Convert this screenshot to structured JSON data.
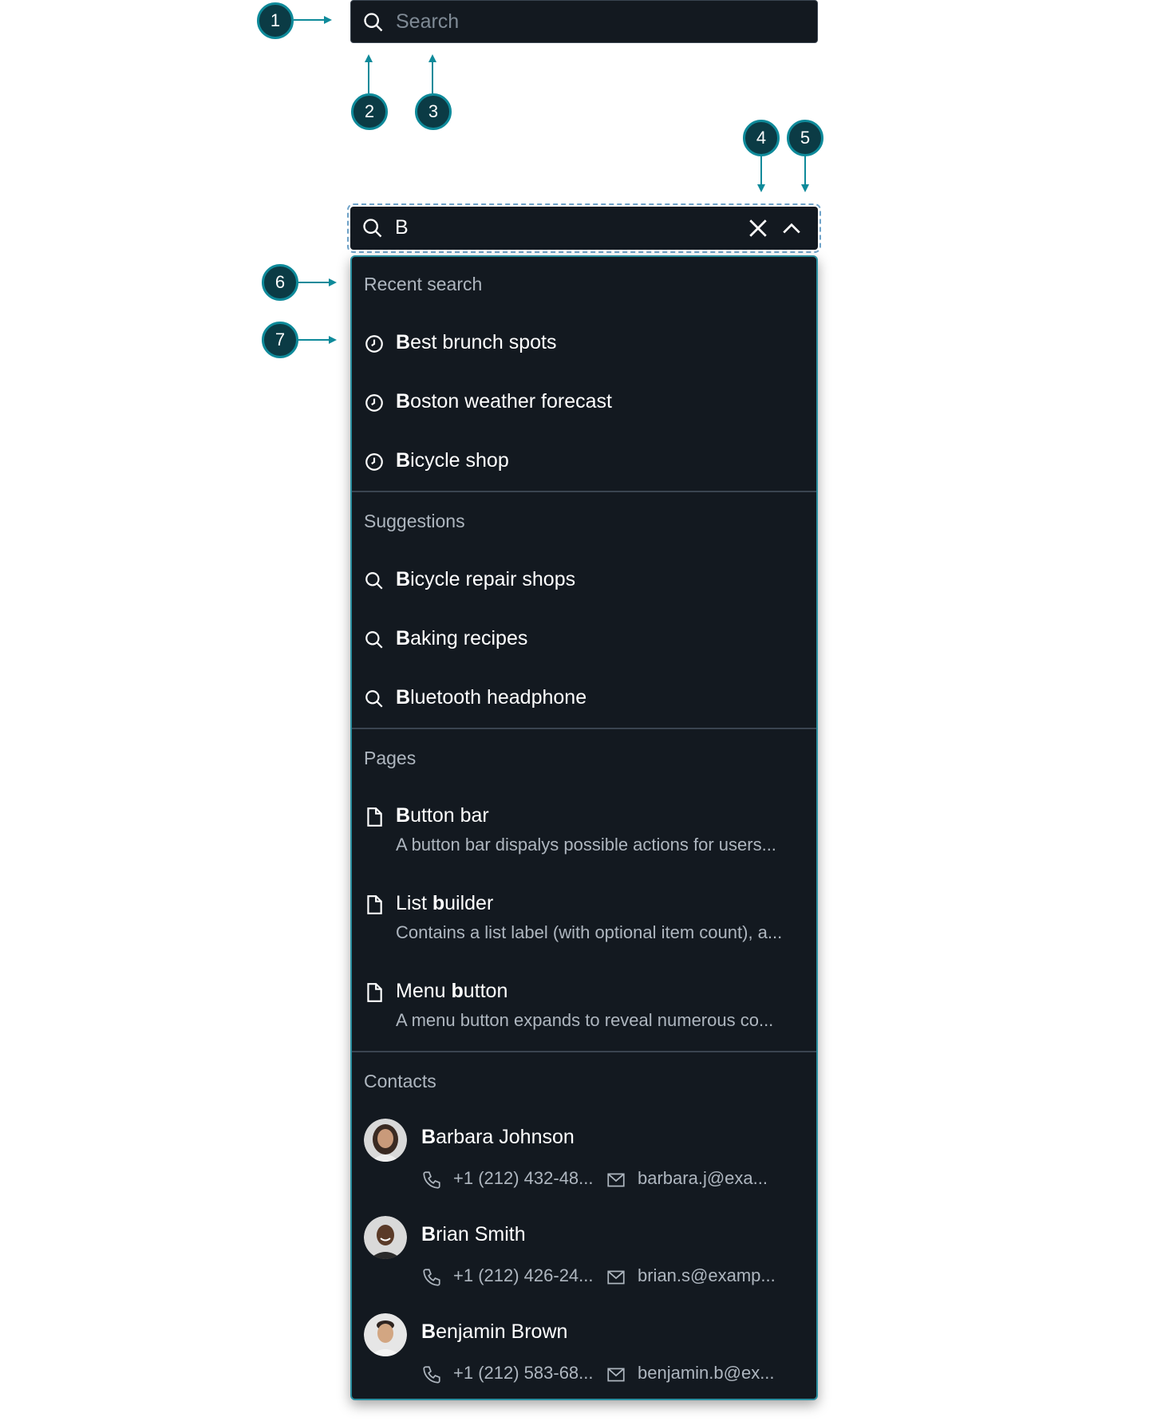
{
  "callouts": [
    "1",
    "2",
    "3",
    "4",
    "5",
    "6",
    "7"
  ],
  "search_collapsed": {
    "placeholder": "Search",
    "icon": "search-icon"
  },
  "search_expanded": {
    "value": "B",
    "icon": "search-icon",
    "clear_icon": "close-icon",
    "collapse_icon": "chevron-up-icon"
  },
  "recent": {
    "heading": "Recent search",
    "items": [
      {
        "lead": "B",
        "rest": "est brunch spots",
        "icon": "clock-icon"
      },
      {
        "lead": "B",
        "rest": "oston weather forecast",
        "icon": "clock-icon"
      },
      {
        "lead": "B",
        "rest": "icycle shop",
        "icon": "clock-icon"
      }
    ]
  },
  "suggestions": {
    "heading": "Suggestions",
    "items": [
      {
        "lead": "B",
        "rest": "icycle repair shops",
        "icon": "search-icon"
      },
      {
        "lead": "B",
        "rest": "aking recipes",
        "icon": "search-icon"
      },
      {
        "lead": "B",
        "rest": "luetooth headphone",
        "icon": "search-icon"
      }
    ]
  },
  "pages": {
    "heading": "Pages",
    "items": [
      {
        "pre": "",
        "lead": "B",
        "rest": "utton bar",
        "desc": "A button bar dispalys possible actions for users...",
        "icon": "document-icon"
      },
      {
        "pre": "List ",
        "lead": "b",
        "rest": "uilder",
        "desc": "Contains a list label (with optional item count), a...",
        "icon": "document-icon"
      },
      {
        "pre": "Menu ",
        "lead": "b",
        "rest": "utton",
        "desc": "A menu button expands to reveal numerous co...",
        "icon": "document-icon"
      }
    ]
  },
  "contacts": {
    "heading": "Contacts",
    "items": [
      {
        "first": "Barbara Johnson",
        "phone": "+1 (212) 432-48...",
        "email": "barbara.j@exa..."
      },
      {
        "first": "Brian Smith",
        "phone": "+1 (212) 426-24...",
        "email": "brian.s@examp..."
      },
      {
        "first": "Benjamin Brown",
        "phone": "+1 (212) 583-68...",
        "email": "benjamin.b@ex..."
      }
    ]
  },
  "colors": {
    "panel_bg": "#131920",
    "accent": "#0e8a9a",
    "badge_bg": "#0b3b45",
    "muted_text": "#aeb6bf"
  }
}
